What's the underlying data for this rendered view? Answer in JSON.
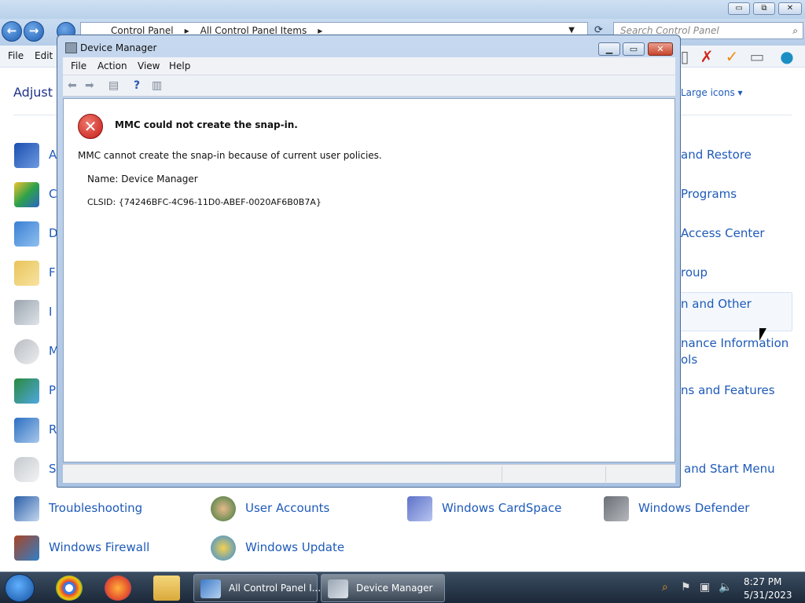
{
  "control_panel": {
    "address": {
      "crumbs": [
        "Control Panel",
        "All Control Panel Items"
      ],
      "search_placeholder": "Search Control Panel"
    },
    "menu": [
      "File",
      "Edit"
    ],
    "heading_partial": "Adjust y",
    "view_by": "Large icons",
    "left_items": [
      {
        "label": "A",
        "icon": "action-center-flag-icon"
      },
      {
        "label": "C",
        "icon": "color-management-icon"
      },
      {
        "label": "D",
        "icon": "display-icon"
      },
      {
        "label": "F",
        "icon": "folder-options-icon"
      },
      {
        "label": "I",
        "icon": "indexing-options-icon"
      },
      {
        "label": "M",
        "icon": "mouse-icon"
      },
      {
        "label": "P",
        "icon": "personalization-icon"
      },
      {
        "label": "R",
        "icon": "region-icon"
      },
      {
        "label": "S",
        "icon": "speech-recognition-icon"
      }
    ],
    "right_items": [
      "and Restore",
      "Programs",
      "Access Center",
      "roup",
      "n and Other",
      "nance Information",
      "ols",
      "ns and Features",
      "and Start Menu"
    ],
    "bottom_row1": [
      {
        "label": "Troubleshooting",
        "icon": "troubleshooting-icon"
      },
      {
        "label": "User Accounts",
        "icon": "user-accounts-icon"
      },
      {
        "label": "Windows CardSpace",
        "icon": "cardspace-icon"
      },
      {
        "label": "Windows Defender",
        "icon": "defender-icon"
      }
    ],
    "bottom_row2": [
      {
        "label": "Windows Firewall",
        "icon": "firewall-icon"
      },
      {
        "label": "Windows Update",
        "icon": "windows-update-icon"
      }
    ]
  },
  "device_manager": {
    "title": "Device Manager",
    "menu": [
      "File",
      "Action",
      "View",
      "Help"
    ],
    "error_title": "MMC could not create the snap-in.",
    "error_message": "MMC cannot create the snap-in because of current user policies.",
    "name_line": "Name: Device Manager",
    "clsid_line": "CLSID: {74246BFC-4C96-11D0-ABEF-0020AF6B0B7A}"
  },
  "taskbar": {
    "tasks": [
      {
        "label": "All Control Panel I...",
        "icon": "control-panel-icon"
      },
      {
        "label": "Device Manager",
        "icon": "device-manager-icon"
      }
    ],
    "clock_time": "8:27 PM",
    "clock_date": "5/31/2023"
  }
}
